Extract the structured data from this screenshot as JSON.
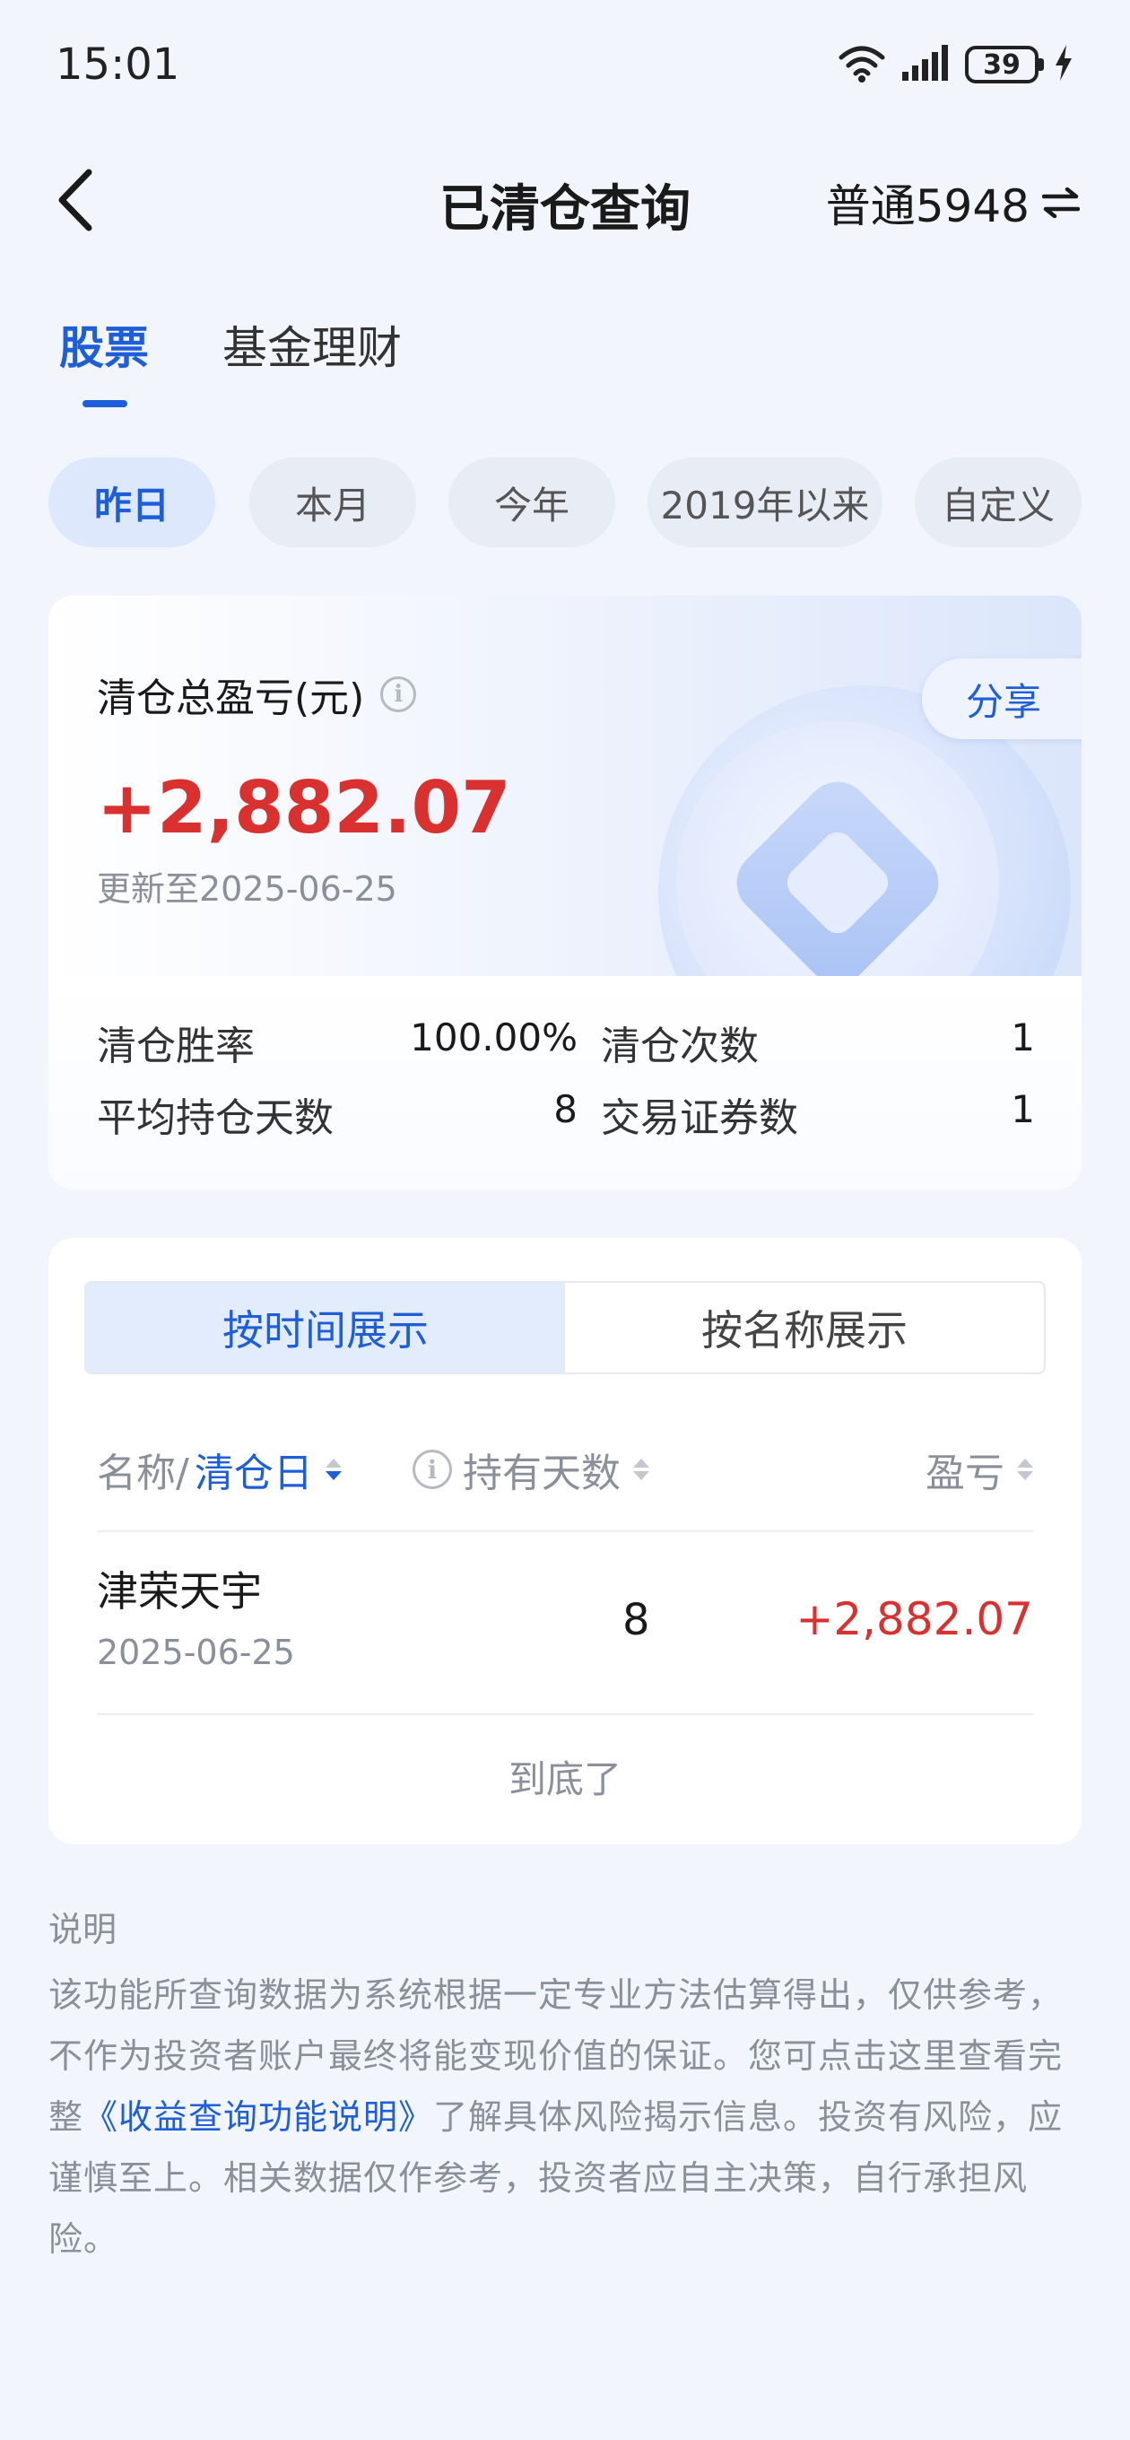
{
  "status_bar": {
    "time": "15:01",
    "battery": "39"
  },
  "nav": {
    "title": "已清仓查询",
    "account": "普通5948"
  },
  "tabs": [
    {
      "label": "股票",
      "active": true
    },
    {
      "label": "基金理财",
      "active": false
    }
  ],
  "periods": [
    {
      "label": "昨日",
      "active": true
    },
    {
      "label": "本月",
      "active": false
    },
    {
      "label": "今年",
      "active": false
    },
    {
      "label": "2019年以来",
      "active": false
    },
    {
      "label": "自定义",
      "active": false
    }
  ],
  "summary": {
    "label": "清仓总盈亏(元)",
    "share": "分享",
    "total_pnl": "+2,882.07",
    "updated": "更新至2025-06-25",
    "stats": {
      "win_rate_label": "清仓胜率",
      "win_rate": "100.00%",
      "clear_count_label": "清仓次数",
      "clear_count": "1",
      "avg_days_label": "平均持仓天数",
      "avg_days": "8",
      "securities_label": "交易证券数",
      "securities": "1"
    }
  },
  "detail": {
    "segments": [
      {
        "label": "按时间展示",
        "active": true
      },
      {
        "label": "按名称展示",
        "active": false
      }
    ],
    "headers": {
      "name_prefix": "名称/",
      "name_sort": "清仓日",
      "days": "持有天数",
      "pnl": "盈亏"
    },
    "rows": [
      {
        "name": "津荣天宇",
        "date": "2025-06-25",
        "days": "8",
        "pnl": "+2,882.07"
      }
    ],
    "end_text": "到底了"
  },
  "notes": {
    "title": "说明",
    "text_before": "该功能所查询数据为系统根据一定专业方法估算得出，仅供参考，不作为投资者账户最终将能变现价值的保证。您可点击这里查看完整",
    "link": "《收益查询功能说明》",
    "text_after": "了解具体风险揭示信息。投资有风险，应谨慎至上。相关数据仅作参考，投资者应自主决策，自行承担风险。"
  },
  "colors": {
    "accent": "#1e5fd9",
    "profit": "#d9312f",
    "background": "#f2f5fc"
  }
}
